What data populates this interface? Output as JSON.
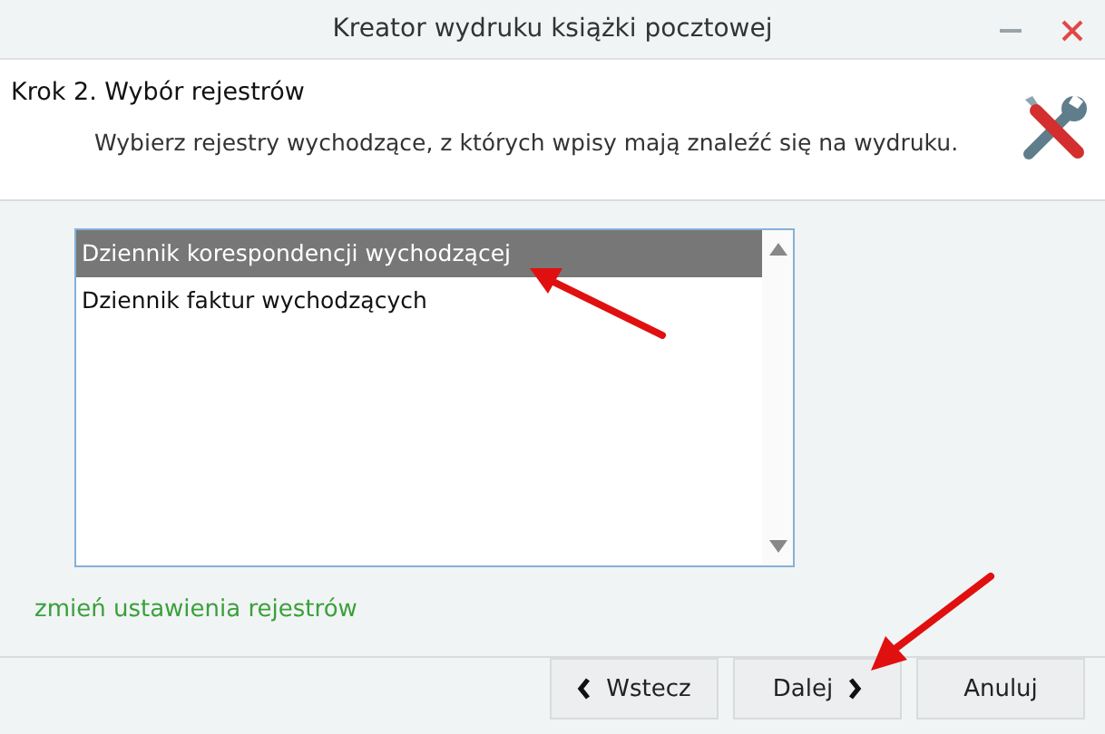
{
  "window": {
    "title": "Kreator wydruku książki pocztowej"
  },
  "step": {
    "title": "Krok 2. Wybór rejestrów",
    "description": "Wybierz rejestry wychodzące, z których wpisy mają znaleźć się na wydruku."
  },
  "registers": [
    {
      "label": "Dziennik korespondencji wychodzącej",
      "selected": true
    },
    {
      "label": "Dziennik faktur wychodzących",
      "selected": false
    }
  ],
  "settings_link": "zmień ustawienia rejestrów",
  "buttons": [
    {
      "label": "Wstecz",
      "kind": "back"
    },
    {
      "label": "Dalej",
      "kind": "next"
    },
    {
      "label": "Anuluj",
      "kind": "plain"
    }
  ]
}
